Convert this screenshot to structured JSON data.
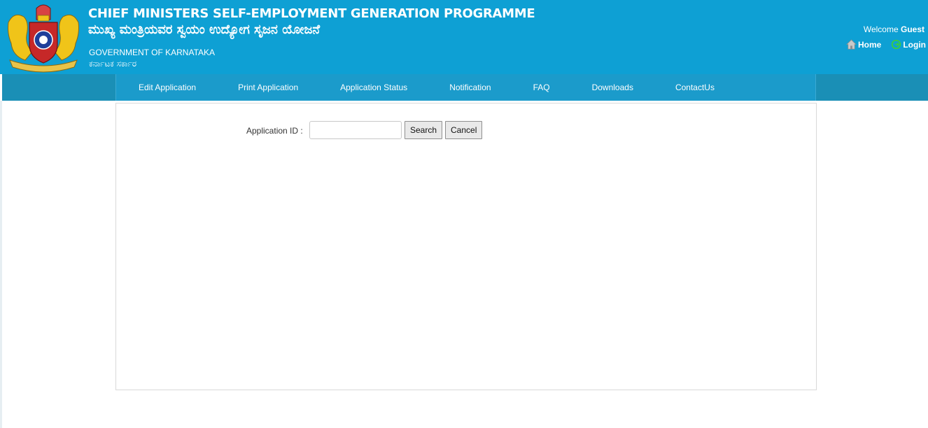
{
  "header": {
    "title_en": "CHIEF MINISTERS SELF-EMPLOYMENT GENERATION PROGRAMME",
    "title_kn": "ಮುಖ್ಯ ಮಂತ್ರಿಯವರ ಸ್ವಯಂ ಉದ್ಯೋಗ ಸೃಜನ ಯೋಜನೆ",
    "gov_en": "GOVERNMENT OF KARNATAKA",
    "gov_kn": "ಕರ್ನಾಟಕ ಸರ್ಕಾರ",
    "welcome_prefix": "Welcome",
    "welcome_user": "Guest",
    "home_label": "Home",
    "login_label": "Login",
    "emblem_icon": "karnataka-emblem-icon",
    "background_color": "#0ea0d4"
  },
  "nav": {
    "items": [
      {
        "label": "Edit Application"
      },
      {
        "label": "Print Application"
      },
      {
        "label": "Application Status"
      },
      {
        "label": "Notification"
      },
      {
        "label": "FAQ"
      },
      {
        "label": "Downloads"
      },
      {
        "label": "ContactUs"
      }
    ],
    "background_color": "#1b9bcb"
  },
  "form": {
    "application_id_label": "Application ID :",
    "application_id_value": "",
    "search_label": "Search",
    "cancel_label": "Cancel"
  }
}
